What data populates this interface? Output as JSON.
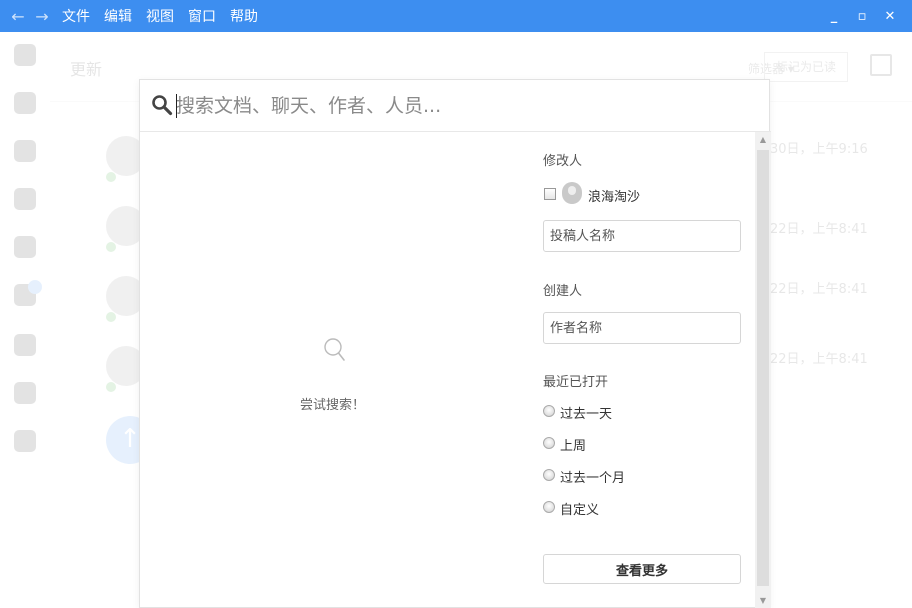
{
  "titlebar": {
    "back_icon": "←",
    "forward_icon": "→",
    "menu": [
      "文件",
      "编辑",
      "视图",
      "窗口",
      "帮助"
    ],
    "minimize_icon": "_",
    "maximize_icon": "▫",
    "close_icon": "✕",
    "bg_color": "#3d8ef0"
  },
  "background_app": {
    "header_title": "更新",
    "filter_label": "筛选器 ▾",
    "mark_read": "标记为已读",
    "feed_times": [
      "30日，上午9:16",
      "22日，上午8:41",
      "22日，上午8:41",
      "22日，上午8:41"
    ]
  },
  "search": {
    "placeholder": "搜索文档、聊天、作者、人员..."
  },
  "empty_state": {
    "hint": "尝试搜索！"
  },
  "filters": {
    "modifier_title": "修改人",
    "modifier_user": "浪海淘沙",
    "modifier_placeholder": "投稿人名称",
    "creator_title": "创建人",
    "creator_placeholder": "作者名称",
    "recent_title": "最近已打开",
    "recent_options": [
      "过去一天",
      "上周",
      "过去一个月",
      "自定义"
    ],
    "more_button": "查看更多"
  }
}
